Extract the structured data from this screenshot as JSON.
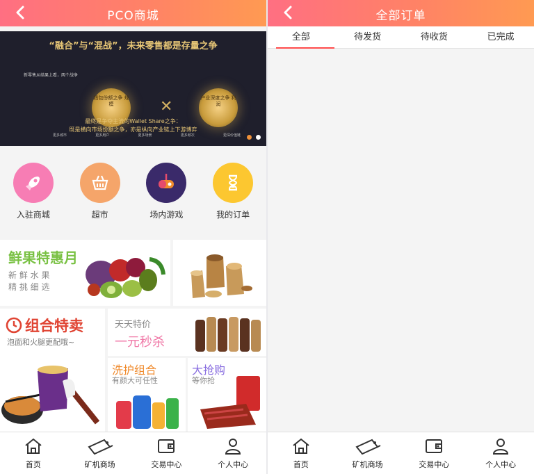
{
  "left": {
    "title": "PCO商城",
    "banner": {
      "headline": "“融合”与“混战”，未来零售都是存量之争",
      "sidenote": "新零售从结果上看，两个战争",
      "coin_left": "钱包份额之争 规模",
      "coin_right": "产业深度之争 利润",
      "tags": [
        "更多城市",
        "更多用户",
        "更多场景",
        "更多频次",
        "更深价值链"
      ],
      "summary_line1": "最终是争夺主流的Wallet Share之争：",
      "summary_line2": "既是横向市场份额之争，亦是纵向产业链上下游博弈"
    },
    "menu": [
      {
        "label": "入驻商城",
        "icon": "rocket-icon",
        "color": "#f77db4"
      },
      {
        "label": "超市",
        "icon": "basket-icon",
        "color": "#f5a56a"
      },
      {
        "label": "场内游戏",
        "icon": "game-icon",
        "color": "#3a2a6a"
      },
      {
        "label": "我的订单",
        "icon": "hourglass-icon",
        "color": "#fcc730"
      }
    ],
    "promos": {
      "fruit_title": "鲜果特惠月",
      "fruit_sub1": "新 鲜 水 果",
      "fruit_sub2": "精 挑 细 选",
      "combo_title": "组合特卖",
      "combo_sub": "泡面和火腿更配哦~",
      "daily_title": "天天特价",
      "daily_sub": "一元秒杀",
      "wash_title": "洗护组合",
      "wash_sub": "有颜大可任性",
      "grab_title": "大抢购",
      "grab_sub": "等你抢"
    }
  },
  "right": {
    "title": "全部订单",
    "tabs": [
      "全部",
      "待发货",
      "待收货",
      "已完成"
    ]
  },
  "nav": [
    {
      "label": "首页",
      "icon": "home-icon"
    },
    {
      "label": "矿机商场",
      "icon": "mining-machine-icon"
    },
    {
      "label": "交易中心",
      "icon": "wallet-icon"
    },
    {
      "label": "个人中心",
      "icon": "user-icon"
    }
  ],
  "colors": {
    "header_gradient_start": "#ff6f82",
    "header_gradient_end": "#ff9a52",
    "tab_underline": "#ff4b4b"
  }
}
